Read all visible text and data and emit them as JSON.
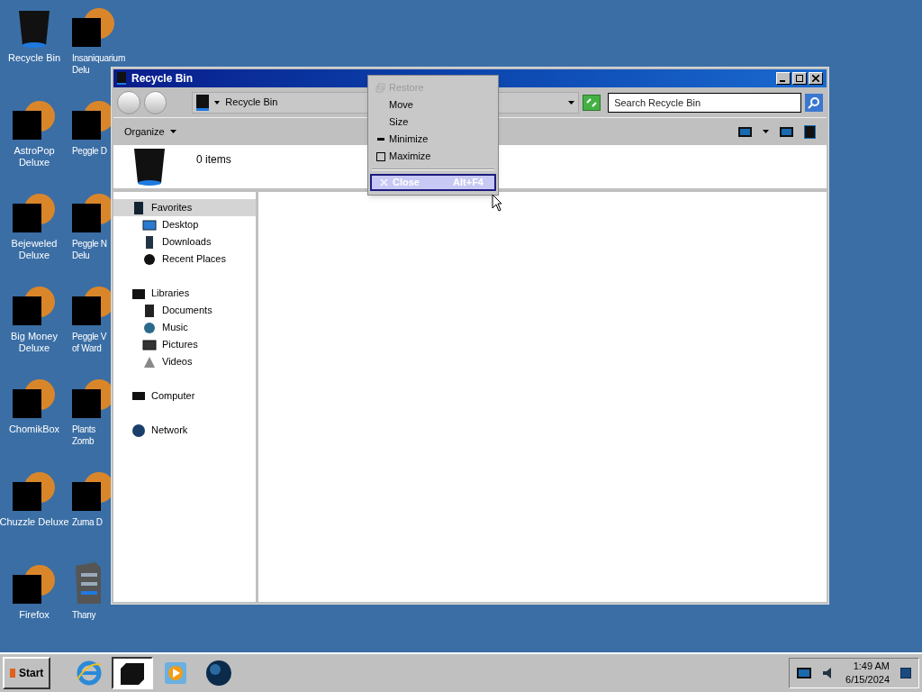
{
  "desktop_icons": [
    {
      "kind": "bin",
      "lines": [
        "Recycle Bin"
      ]
    },
    {
      "kind": "covered",
      "lines": [
        "Insaniquarium",
        "Delu"
      ]
    },
    {
      "kind": "covered",
      "lines": [
        "AstroPop",
        "Deluxe"
      ]
    },
    {
      "kind": "covered",
      "lines": [
        "Peggle D"
      ]
    },
    {
      "kind": "covered",
      "lines": [
        "Bejeweled",
        "Deluxe"
      ]
    },
    {
      "kind": "covered",
      "lines": [
        "Peggle N",
        "Delu"
      ]
    },
    {
      "kind": "covered",
      "lines": [
        "Big Money",
        "Deluxe"
      ]
    },
    {
      "kind": "covered",
      "lines": [
        "Peggle V",
        "of Ward"
      ]
    },
    {
      "kind": "covered",
      "lines": [
        "ChomikBox"
      ]
    },
    {
      "kind": "covered",
      "lines": [
        "Plants",
        "Zomb"
      ]
    },
    {
      "kind": "covered",
      "lines": [
        "Chuzzle Deluxe"
      ]
    },
    {
      "kind": "covered",
      "lines": [
        "Zuma D"
      ]
    },
    {
      "kind": "covered",
      "lines": [
        "Firefox"
      ]
    },
    {
      "kind": "server",
      "lines": [
        "Thany"
      ]
    }
  ],
  "window": {
    "title": "Recycle Bin",
    "address": "Recycle Bin",
    "search": {
      "placeholder": "Search Recycle Bin"
    },
    "organize": "Organize",
    "item_count": "0 items",
    "nav": [
      {
        "label": "Favorites",
        "kind": "favorites",
        "selected": true,
        "children": [
          {
            "label": "Desktop",
            "kind": "desktop",
            "selected": false
          },
          {
            "label": "Downloads",
            "kind": "downloads",
            "selected": false
          },
          {
            "label": "Recent Places",
            "kind": "recent",
            "selected": false
          }
        ]
      },
      {
        "label": "Libraries",
        "kind": "libraries",
        "selected": false,
        "children": [
          {
            "label": "Documents",
            "kind": "documents",
            "selected": false
          },
          {
            "label": "Music",
            "kind": "music",
            "selected": false
          },
          {
            "label": "Pictures",
            "kind": "pictures",
            "selected": false
          },
          {
            "label": "Videos",
            "kind": "videos",
            "selected": false
          }
        ]
      },
      {
        "label": "Computer",
        "kind": "computer",
        "selected": false
      },
      {
        "label": "Network",
        "kind": "network",
        "selected": false
      }
    ]
  },
  "system_menu": [
    {
      "label": "Restore",
      "kind": "restore",
      "disabled": true,
      "selected": false
    },
    {
      "label": "Move",
      "kind": "plain",
      "disabled": false,
      "selected": false
    },
    {
      "label": "Size",
      "kind": "plain",
      "disabled": false,
      "selected": false
    },
    {
      "label": "Minimize",
      "kind": "minimize",
      "disabled": false,
      "selected": false
    },
    {
      "label": "Maximize",
      "kind": "maximize",
      "disabled": false,
      "selected": false
    },
    {
      "label": "Close",
      "kind": "close",
      "shortcut": "Alt+F4",
      "disabled": false,
      "selected": true,
      "separator_before": true
    }
  ],
  "taskbar": {
    "start": "Start",
    "apps": [
      {
        "kind": "browser",
        "selected": false
      },
      {
        "kind": "explorer",
        "selected": true
      },
      {
        "kind": "media",
        "selected": false
      },
      {
        "kind": "globe",
        "selected": false
      }
    ],
    "time": "1:49 AM",
    "date": "6/15/2024"
  }
}
